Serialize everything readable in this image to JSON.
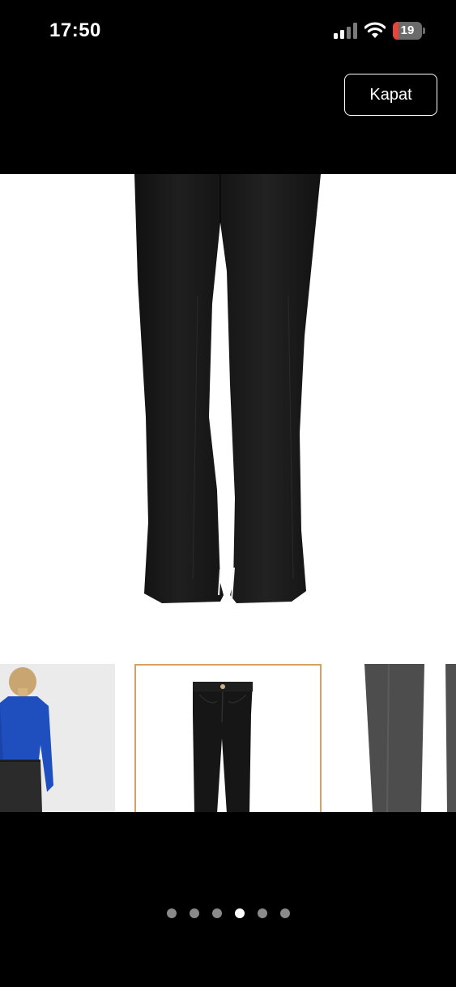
{
  "status_bar": {
    "time": "17:50",
    "battery_level": "19",
    "battery_fraction": 0.19,
    "battery_color": "#e5453a",
    "signal_icon": "cellular-signal-icon",
    "wifi_icon": "wifi-icon"
  },
  "header": {
    "close_label": "Kapat"
  },
  "gallery": {
    "main_image": "black-flared-jeans-product-photo",
    "thumbnails": [
      {
        "image": "model-back-view-blue-top-black-jeans",
        "selected": false
      },
      {
        "image": "black-jeans-front-view",
        "selected": true
      },
      {
        "image": "jeans-hem-slit-detail",
        "selected": false
      }
    ],
    "selected_border_color": "#d9a15f",
    "pager": {
      "count": 6,
      "active_index": 3
    }
  }
}
